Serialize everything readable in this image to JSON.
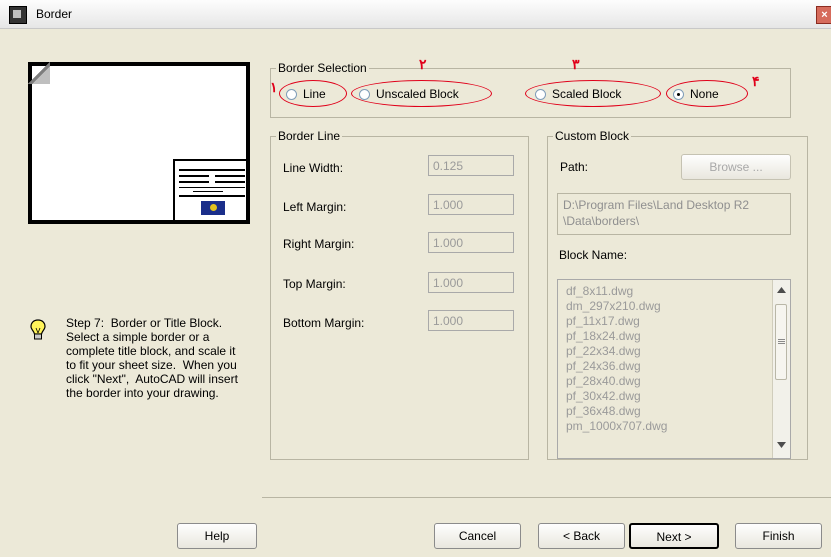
{
  "window": {
    "title": "Border",
    "close_label": "×"
  },
  "step_text": "Step 7:  Border or Title Block.\nSelect a simple border or a\ncomplete title block, and scale it\nto fit your sheet size.  When you\nclick \"Next\",  AutoCAD will insert\nthe border into your drawing.",
  "border_selection": {
    "legend": "Border Selection",
    "options": [
      {
        "label": "Line",
        "selected": false,
        "annotation": "١"
      },
      {
        "label": "Unscaled Block",
        "selected": false,
        "annotation": "٢"
      },
      {
        "label": "Scaled Block",
        "selected": false,
        "annotation": "٣"
      },
      {
        "label": "None",
        "selected": true,
        "annotation": "۴"
      }
    ]
  },
  "border_line": {
    "legend": "Border Line",
    "fields": [
      {
        "label": "Line Width:",
        "value": "0.125"
      },
      {
        "label": "Left Margin:",
        "value": "1.000"
      },
      {
        "label": "Right Margin:",
        "value": "1.000"
      },
      {
        "label": "Top Margin:",
        "value": "1.000"
      },
      {
        "label": "Bottom Margin:",
        "value": "1.000"
      }
    ]
  },
  "custom_block": {
    "legend": "Custom Block",
    "path_label": "Path:",
    "browse_label": "Browse ...",
    "path_value": "D:\\Program Files\\Land Desktop R2\n\\Data\\borders\\",
    "block_name_label": "Block Name:",
    "blocks": [
      "df_8x11.dwg",
      "dm_297x210.dwg",
      "pf_11x17.dwg",
      "pf_18x24.dwg",
      "pf_22x34.dwg",
      "pf_24x36.dwg",
      "pf_28x40.dwg",
      "pf_30x42.dwg",
      "pf_36x48.dwg",
      "pm_1000x707.dwg"
    ]
  },
  "buttons": {
    "help": "Help",
    "cancel": "Cancel",
    "back": "< Back",
    "next": "Next >",
    "finish": "Finish"
  },
  "colors": {
    "annotation": "#e0001a",
    "dialog_bg": "#ece9d8"
  }
}
